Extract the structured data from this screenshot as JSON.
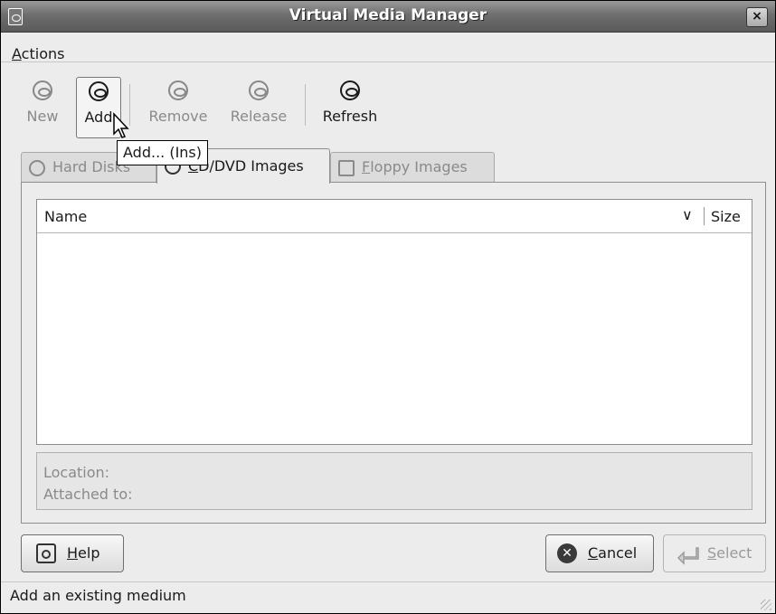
{
  "window": {
    "title": "Virtual Media Manager",
    "close_glyph": "×"
  },
  "menu": {
    "actions": {
      "mnemonic": "A",
      "rest": "ctions"
    }
  },
  "toolbar": {
    "new_label": "New",
    "add_label": "Add",
    "remove_label": "Remove",
    "release_label": "Release",
    "refresh_label": "Refresh"
  },
  "tooltip": {
    "text": "Add... (Ins)"
  },
  "tabs": {
    "hard_disks": {
      "label": "Hard Disks",
      "icon": "hard-disk-icon"
    },
    "cd_dvd": {
      "mnemonic": "C",
      "rest": "D/DVD Images",
      "icon": "cd-icon"
    },
    "floppy": {
      "mnemonic": "F",
      "rest": "loppy Images",
      "icon": "floppy-icon"
    }
  },
  "list": {
    "columns": [
      "Name",
      "Size"
    ],
    "rows": []
  },
  "info": {
    "location_label": "Location:",
    "attached_label": "Attached to:"
  },
  "buttons": {
    "help": {
      "mnemonic": "H",
      "rest": "elp"
    },
    "cancel": {
      "mnemonic": "C",
      "rest": "ancel"
    },
    "select": {
      "mnemonic": "S",
      "rest": "elect"
    }
  },
  "status": {
    "text": "Add an existing medium"
  }
}
